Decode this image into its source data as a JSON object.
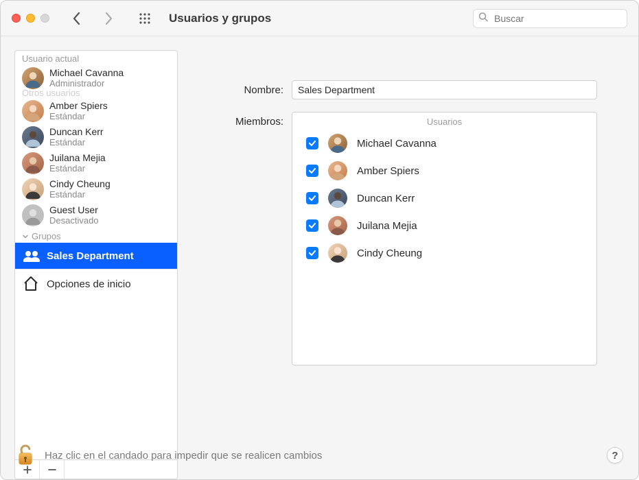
{
  "window": {
    "title": "Usuarios y grupos",
    "search_placeholder": "Buscar"
  },
  "sidebar": {
    "current_user_header": "Usuario actual",
    "other_users_header": "Otros usuarios",
    "groups_header": "Grupos",
    "login_options": "Opciones de inicio",
    "current_user": {
      "name": "Michael Cavanna",
      "role": "Administrador"
    },
    "others": [
      {
        "name": "Amber Spiers",
        "role": "Estándar"
      },
      {
        "name": "Duncan Kerr",
        "role": "Estándar"
      },
      {
        "name": "Juilana Mejia",
        "role": "Estándar"
      },
      {
        "name": "Cindy Cheung",
        "role": "Estándar"
      },
      {
        "name": "Guest User",
        "role": "Desactivado"
      }
    ],
    "groups": [
      {
        "name": "Sales Department",
        "selected": true
      }
    ]
  },
  "main": {
    "name_label": "Nombre:",
    "name_value": "Sales Department",
    "members_label": "Miembros:",
    "users_column": "Usuarios",
    "members": [
      {
        "name": "Michael Cavanna",
        "checked": true
      },
      {
        "name": "Amber Spiers",
        "checked": true
      },
      {
        "name": "Duncan Kerr",
        "checked": true
      },
      {
        "name": "Juilana Mejia",
        "checked": true
      },
      {
        "name": "Cindy Cheung",
        "checked": true
      }
    ]
  },
  "lock": {
    "text": "Haz clic en el candado para impedir que se realicen cambios",
    "help": "?"
  }
}
